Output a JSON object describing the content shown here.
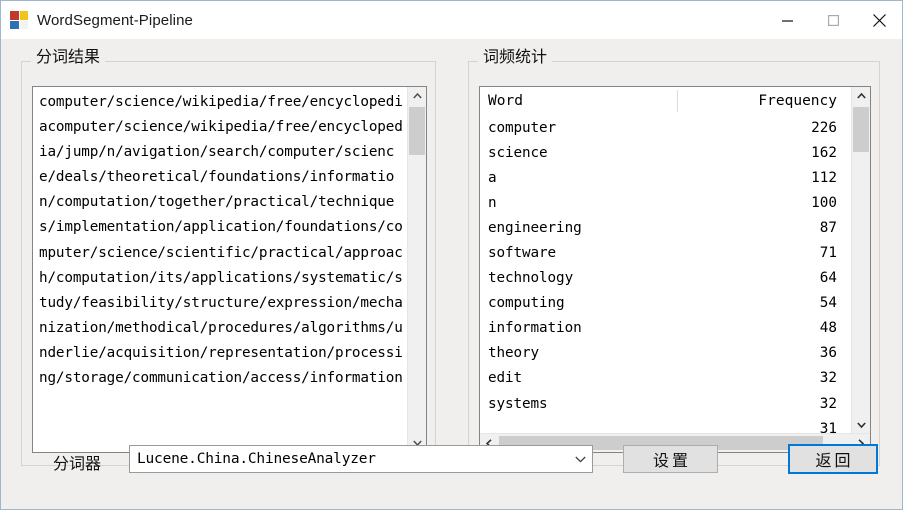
{
  "window": {
    "title": "WordSegment-Pipeline",
    "icon": "app-grid-icon",
    "icon_colors": [
      "#c0392b",
      "#f0c419",
      "#2f6fb5",
      "#f2f2f2"
    ],
    "controls": {
      "minimize": "minimize-icon",
      "maximize": "maximize-icon",
      "close": "close-icon"
    }
  },
  "segmentation_panel": {
    "title": "分词结果",
    "text": "computer/science/wikipedia/free/encyclopediacomputer/science/wikipedia/free/encyclopedia/jump/n/avigation/search/computer/science/deals/theoretical/foundations/information/computation/together/practical/techniques/implementation/application/foundations/computer/science/scientific/practical/approach/computation/its/applications/systematic/study/feasibility/structure/expression/mechanization/methodical/procedures/algorithms/underlie/acquisition/representation/processing/storage/communication/access/information"
  },
  "frequency_panel": {
    "title": "词频统计",
    "columns": {
      "word": "Word",
      "frequency": "Frequency"
    },
    "rows": [
      {
        "word": "computer",
        "freq": "226"
      },
      {
        "word": "science",
        "freq": "162"
      },
      {
        "word": "a",
        "freq": "112"
      },
      {
        "word": "n",
        "freq": "100"
      },
      {
        "word": "engineering",
        "freq": "87"
      },
      {
        "word": "software",
        "freq": "71"
      },
      {
        "word": "technology",
        "freq": "64"
      },
      {
        "word": "computing",
        "freq": "54"
      },
      {
        "word": "information",
        "freq": "48"
      },
      {
        "word": "theory",
        "freq": "36"
      },
      {
        "word": "edit",
        "freq": "32"
      },
      {
        "word": "systems",
        "freq": "32"
      },
      {
        "word": "",
        "freq": "31"
      }
    ]
  },
  "bottom_bar": {
    "tokenizer_label": "分词器",
    "tokenizer_value": "Lucene.China.ChineseAnalyzer",
    "settings_button": "设置",
    "back_button": "返回"
  },
  "colors": {
    "focus_accent": "#0078d7",
    "window_bg": "#f0efed",
    "field_bg": "#ffffff",
    "scroll_thumb": "#cdcdcd"
  }
}
